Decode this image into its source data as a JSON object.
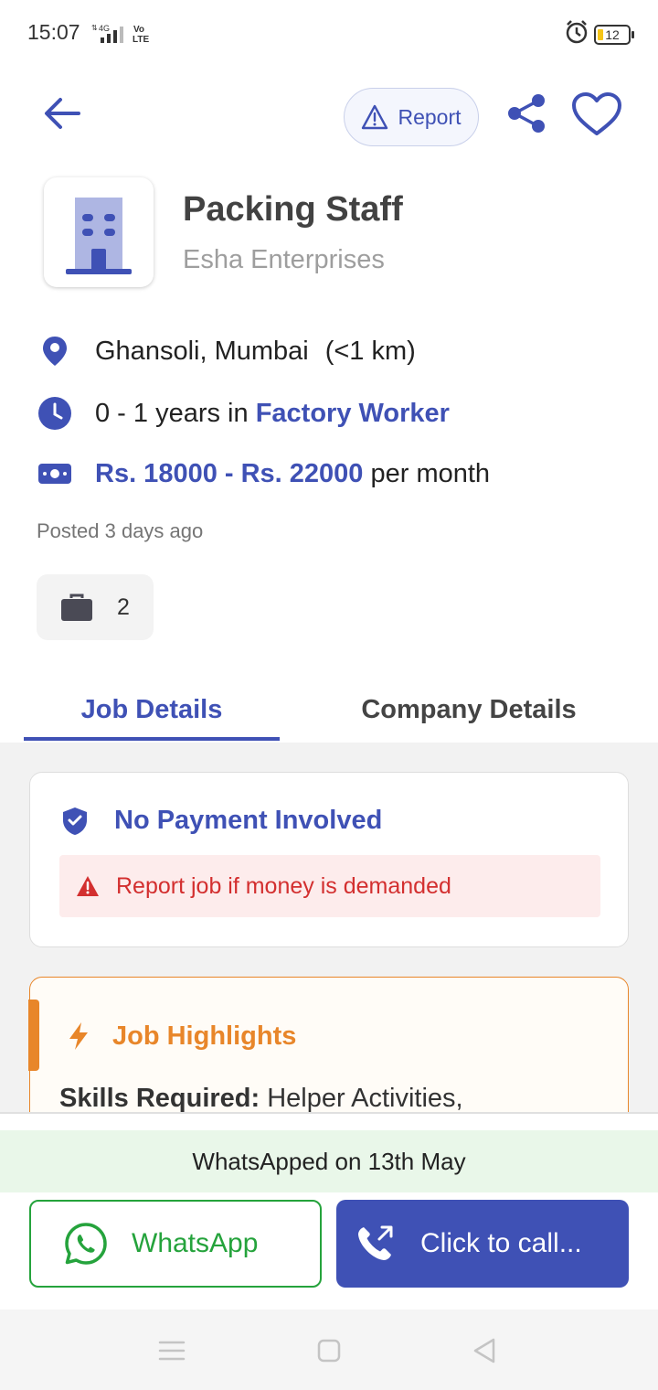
{
  "status_bar": {
    "time": "15:07",
    "network": "4G",
    "volte": "Vo LTE",
    "battery": "12"
  },
  "header": {
    "report_label": "Report"
  },
  "job": {
    "title": "Packing Staff",
    "company": "Esha Enterprises",
    "location": "Ghansoli, Mumbai",
    "distance": "(<1 km)",
    "experience_prefix": "0 - 1 years in ",
    "experience_role": "Factory Worker",
    "salary_range": "Rs. 18000 - Rs. 22000",
    "salary_suffix": " per month",
    "posted": "Posted 3 days ago",
    "openings": "2"
  },
  "tabs": [
    {
      "label": "Job Details",
      "active": true
    },
    {
      "label": "Company Details",
      "active": false
    }
  ],
  "safety": {
    "title": "No Payment Involved",
    "warning": "Report job if money is demanded"
  },
  "highlights": {
    "title": "Job Highlights",
    "skills_label": "Skills Required:",
    "skills_value": " Helper Activities,"
  },
  "footer": {
    "whatsapped": "WhatsApped on 13th May",
    "whatsapp_label": "WhatsApp",
    "call_label": "Click to call..."
  },
  "colors": {
    "primary": "#3f51b5",
    "whatsapp_green": "#25a33c",
    "highlight_orange": "#e8862a",
    "warning_red": "#d32f2f"
  }
}
